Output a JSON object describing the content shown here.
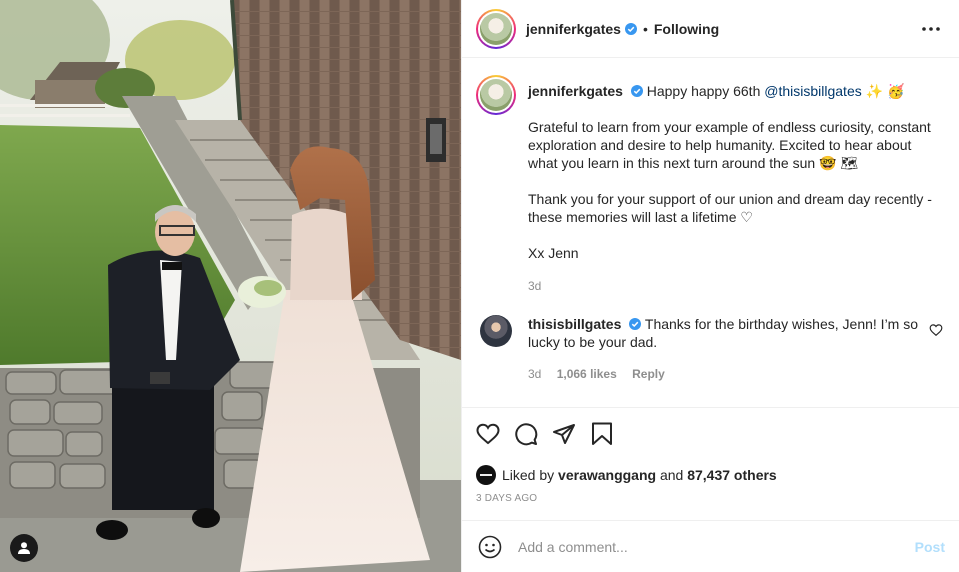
{
  "post": {
    "author": "jenniferkgates",
    "separator": "•",
    "follow_status": "Following",
    "more_icon": "more-options-icon"
  },
  "caption": {
    "username": "jenniferkgates",
    "line1_text": "Happy happy 66th",
    "mention": "@thisisbillgates",
    "line1_emojis": "✨ 🥳",
    "para1": "Grateful to learn from your example of endless curiosity, constant exploration and desire to help humanity. Excited to hear about what you learn in this next turn around the sun 🤓 🗺",
    "para2": "Thank you for your support of our union and dream day recently - these memories will last a lifetime ♡",
    "para3": "Xx Jenn",
    "time": "3d"
  },
  "reply": {
    "username": "thisisbillgates",
    "text": "Thanks for the birthday wishes, Jenn! I’m so lucky to be your dad.",
    "time": "3d",
    "likes": "1,066 likes",
    "reply_label": "Reply"
  },
  "likes": {
    "prefix": "Liked by",
    "user": "verawanggang",
    "connector": "and",
    "others": "87,437 others"
  },
  "timestamp": "3 DAYS AGO",
  "comment_box": {
    "placeholder": "Add a comment...",
    "post_label": "Post"
  },
  "colors": {
    "verified": "#3897f0",
    "link": "#00376b",
    "post_disabled": "#b2dffc",
    "muted": "#8e8e8e"
  }
}
